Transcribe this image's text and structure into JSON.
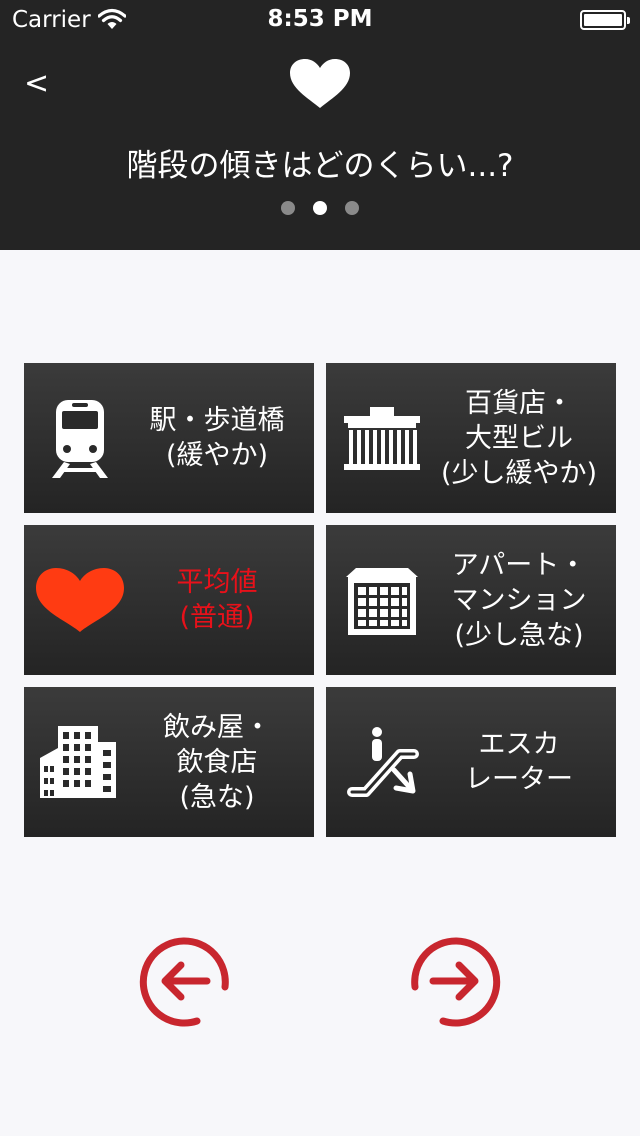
{
  "status_bar": {
    "carrier": "Carrier",
    "time": "8:53 PM"
  },
  "header": {
    "back_label": "<",
    "question": "階段の傾きはどのくらい...?",
    "page_indicator": {
      "count": 3,
      "current": 2
    }
  },
  "options": [
    {
      "id": "station",
      "icon": "train-icon",
      "label": "駅・歩道橋\n(緩やか)",
      "selected": false
    },
    {
      "id": "department-store",
      "icon": "department-store-icon",
      "label": "百貨店・\n大型ビル\n(少し緩やか)",
      "selected": false
    },
    {
      "id": "average",
      "icon": "heart-icon",
      "label": "平均値\n(普通)",
      "selected": true
    },
    {
      "id": "apartment",
      "icon": "apartment-building-icon",
      "label": "アパート・\nマンション\n(少し急な)",
      "selected": false
    },
    {
      "id": "bar",
      "icon": "office-buildings-icon",
      "label": "飲み屋・\n飲食店\n(急な)",
      "selected": false
    },
    {
      "id": "escalator",
      "icon": "escalator-icon",
      "label": "エスカ\nレーター",
      "selected": false
    }
  ],
  "colors": {
    "header_bg": "#242424",
    "page_bg": "#f7f7fa",
    "selected_text": "#e8111a",
    "selected_heart": "#ff3b12",
    "nav_arrow": "#c8262e"
  },
  "navigation": {
    "prev": "arrow-left-circle-icon",
    "next": "arrow-right-circle-icon"
  }
}
